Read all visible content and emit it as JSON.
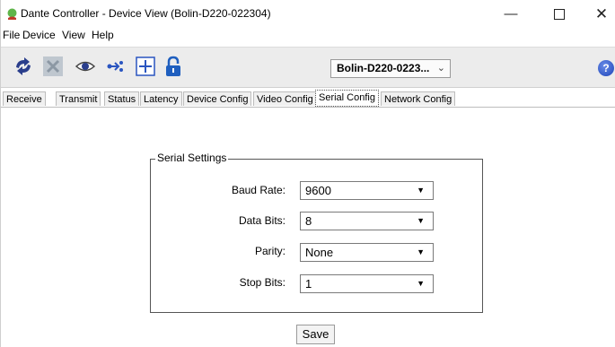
{
  "window": {
    "title": "Dante Controller - Device View (Bolin-D220-022304)",
    "controls": {
      "minimize": "—",
      "close": "✕"
    }
  },
  "menu": {
    "items": [
      "File",
      "Device",
      "View",
      "Help"
    ]
  },
  "toolbar": {
    "icons": [
      "refresh-icon",
      "cross-icon",
      "eye-icon",
      "network-icon",
      "add-icon",
      "lock-icon"
    ],
    "device_select": "Bolin-D220-0223...",
    "help": "?"
  },
  "tabs": [
    "Receive",
    "Transmit",
    "Status",
    "Latency",
    "Device Config",
    "Video Config",
    "Serial Config",
    "Network Config"
  ],
  "active_tab": "Serial Config",
  "serial_settings": {
    "legend": "Serial Settings",
    "baud_rate": {
      "label": "Baud Rate:",
      "value": "9600"
    },
    "data_bits": {
      "label": "Data Bits:",
      "value": "8"
    },
    "parity": {
      "label": "Parity:",
      "value": "None"
    },
    "stop_bits": {
      "label": "Stop Bits:",
      "value": "1"
    }
  },
  "save_label": "Save",
  "colors": {
    "toolbar_bg": "#ececec",
    "help_blue": "#1d44b8",
    "refresh_blue": "#2a3e8c",
    "lock_blue": "#1f5fbf"
  }
}
